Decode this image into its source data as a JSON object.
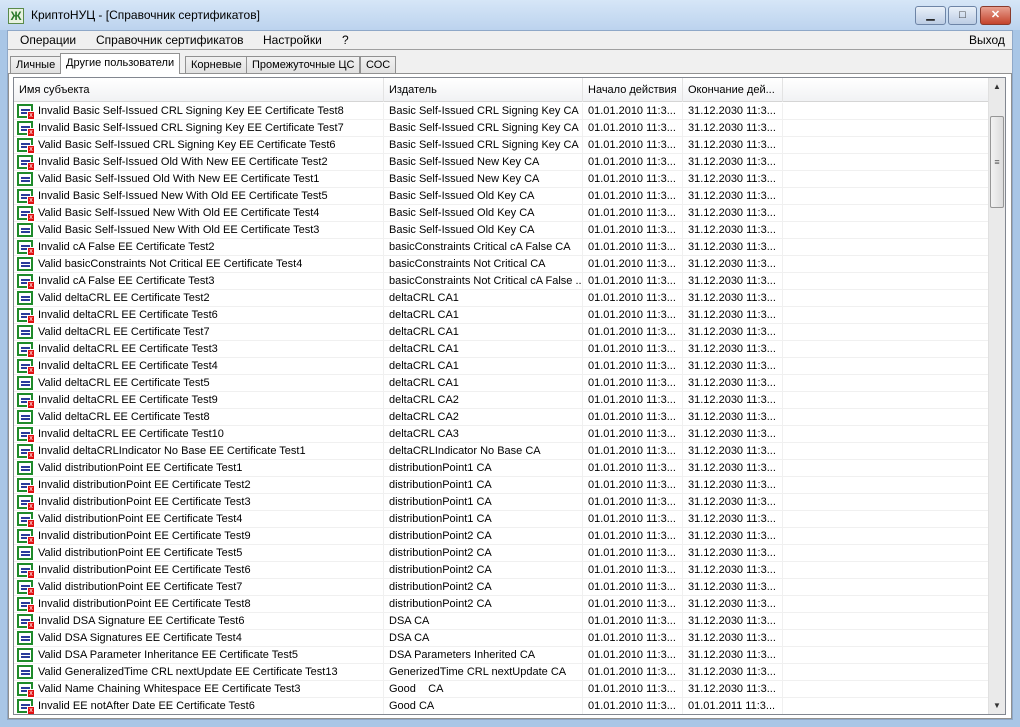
{
  "window": {
    "title": "КриптоНУЦ - [Справочник сертификатов]",
    "minimize": "▁",
    "maximize": "□",
    "close": "✕",
    "app_icon": "Ж"
  },
  "menu": {
    "items": [
      "Операции",
      "Справочник сертификатов",
      "Настройки",
      "?"
    ],
    "exit": "Выход"
  },
  "tabs": [
    "Личные",
    "Другие пользователи",
    "Корневые",
    "Промежуточные ЦС",
    "СОС"
  ],
  "active_tab": 1,
  "columns": [
    "Имя субъекта",
    "Издатель",
    "Начало действия",
    "Окончание дей..."
  ],
  "colors": {
    "valid_icon": "#1e8a2a",
    "error_badge": "#e01010"
  },
  "rows": [
    {
      "name": "Invalid Basic Self-Issued CRL Signing Key EE Certificate Test8",
      "issuer": "Basic Self-Issued CRL Signing Key CA",
      "start": "01.01.2010 11:3...",
      "end": "31.12.2030 11:3...",
      "error": true
    },
    {
      "name": "Invalid Basic Self-Issued CRL Signing Key EE Certificate Test7",
      "issuer": "Basic Self-Issued CRL Signing Key CA",
      "start": "01.01.2010 11:3...",
      "end": "31.12.2030 11:3...",
      "error": true
    },
    {
      "name": "Valid Basic Self-Issued CRL Signing Key EE Certificate Test6",
      "issuer": "Basic Self-Issued CRL Signing Key CA",
      "start": "01.01.2010 11:3...",
      "end": "31.12.2030 11:3...",
      "error": true
    },
    {
      "name": "Invalid Basic Self-Issued Old With New EE Certificate Test2",
      "issuer": "Basic Self-Issued New Key CA",
      "start": "01.01.2010 11:3...",
      "end": "31.12.2030 11:3...",
      "error": true
    },
    {
      "name": "Valid Basic Self-Issued Old With New EE Certificate Test1",
      "issuer": "Basic Self-Issued New Key CA",
      "start": "01.01.2010 11:3...",
      "end": "31.12.2030 11:3...",
      "error": false
    },
    {
      "name": "Invalid Basic Self-Issued New With Old EE Certificate Test5",
      "issuer": "Basic Self-Issued Old Key CA",
      "start": "01.01.2010 11:3...",
      "end": "31.12.2030 11:3...",
      "error": true
    },
    {
      "name": "Valid Basic Self-Issued New With Old EE Certificate Test4",
      "issuer": "Basic Self-Issued Old Key CA",
      "start": "01.01.2010 11:3...",
      "end": "31.12.2030 11:3...",
      "error": true
    },
    {
      "name": "Valid Basic Self-Issued New With Old EE Certificate Test3",
      "issuer": "Basic Self-Issued Old Key CA",
      "start": "01.01.2010 11:3...",
      "end": "31.12.2030 11:3...",
      "error": false
    },
    {
      "name": "Invalid cA False EE Certificate Test2",
      "issuer": "basicConstraints Critical cA False CA",
      "start": "01.01.2010 11:3...",
      "end": "31.12.2030 11:3...",
      "error": true
    },
    {
      "name": "Valid basicConstraints Not Critical EE Certificate Test4",
      "issuer": "basicConstraints Not Critical CA",
      "start": "01.01.2010 11:3...",
      "end": "31.12.2030 11:3...",
      "error": false
    },
    {
      "name": "Invalid cA False EE Certificate Test3",
      "issuer": "basicConstraints Not Critical cA False ...",
      "start": "01.01.2010 11:3...",
      "end": "31.12.2030 11:3...",
      "error": true
    },
    {
      "name": "Valid deltaCRL EE Certificate Test2",
      "issuer": "deltaCRL CA1",
      "start": "01.01.2010 11:3...",
      "end": "31.12.2030 11:3...",
      "error": false
    },
    {
      "name": "Invalid deltaCRL EE Certificate Test6",
      "issuer": "deltaCRL CA1",
      "start": "01.01.2010 11:3...",
      "end": "31.12.2030 11:3...",
      "error": true
    },
    {
      "name": "Valid deltaCRL EE Certificate Test7",
      "issuer": "deltaCRL CA1",
      "start": "01.01.2010 11:3...",
      "end": "31.12.2030 11:3...",
      "error": false
    },
    {
      "name": "Invalid deltaCRL EE Certificate Test3",
      "issuer": "deltaCRL CA1",
      "start": "01.01.2010 11:3...",
      "end": "31.12.2030 11:3...",
      "error": true
    },
    {
      "name": "Invalid deltaCRL EE Certificate Test4",
      "issuer": "deltaCRL CA1",
      "start": "01.01.2010 11:3...",
      "end": "31.12.2030 11:3...",
      "error": true
    },
    {
      "name": "Valid deltaCRL EE Certificate Test5",
      "issuer": "deltaCRL CA1",
      "start": "01.01.2010 11:3...",
      "end": "31.12.2030 11:3...",
      "error": false
    },
    {
      "name": "Invalid deltaCRL EE Certificate Test9",
      "issuer": "deltaCRL CA2",
      "start": "01.01.2010 11:3...",
      "end": "31.12.2030 11:3...",
      "error": true
    },
    {
      "name": "Valid deltaCRL EE Certificate Test8",
      "issuer": "deltaCRL CA2",
      "start": "01.01.2010 11:3...",
      "end": "31.12.2030 11:3...",
      "error": false
    },
    {
      "name": "Invalid deltaCRL EE Certificate Test10",
      "issuer": "deltaCRL CA3",
      "start": "01.01.2010 11:3...",
      "end": "31.12.2030 11:3...",
      "error": true
    },
    {
      "name": "Invalid deltaCRLIndicator No Base EE Certificate Test1",
      "issuer": "deltaCRLIndicator No Base CA",
      "start": "01.01.2010 11:3...",
      "end": "31.12.2030 11:3...",
      "error": true
    },
    {
      "name": "Valid distributionPoint EE Certificate Test1",
      "issuer": "distributionPoint1 CA",
      "start": "01.01.2010 11:3...",
      "end": "31.12.2030 11:3...",
      "error": false
    },
    {
      "name": "Invalid distributionPoint EE Certificate Test2",
      "issuer": "distributionPoint1 CA",
      "start": "01.01.2010 11:3...",
      "end": "31.12.2030 11:3...",
      "error": true
    },
    {
      "name": "Invalid distributionPoint EE Certificate Test3",
      "issuer": "distributionPoint1 CA",
      "start": "01.01.2010 11:3...",
      "end": "31.12.2030 11:3...",
      "error": true
    },
    {
      "name": "Valid distributionPoint EE Certificate Test4",
      "issuer": "distributionPoint1 CA",
      "start": "01.01.2010 11:3...",
      "end": "31.12.2030 11:3...",
      "error": true
    },
    {
      "name": "Invalid distributionPoint EE Certificate Test9",
      "issuer": "distributionPoint2 CA",
      "start": "01.01.2010 11:3...",
      "end": "31.12.2030 11:3...",
      "error": true
    },
    {
      "name": "Valid distributionPoint EE Certificate Test5",
      "issuer": "distributionPoint2 CA",
      "start": "01.01.2010 11:3...",
      "end": "31.12.2030 11:3...",
      "error": false
    },
    {
      "name": "Invalid distributionPoint EE Certificate Test6",
      "issuer": "distributionPoint2 CA",
      "start": "01.01.2010 11:3...",
      "end": "31.12.2030 11:3...",
      "error": true
    },
    {
      "name": "Valid distributionPoint EE Certificate Test7",
      "issuer": "distributionPoint2 CA",
      "start": "01.01.2010 11:3...",
      "end": "31.12.2030 11:3...",
      "error": true
    },
    {
      "name": "Invalid distributionPoint EE Certificate Test8",
      "issuer": "distributionPoint2 CA",
      "start": "01.01.2010 11:3...",
      "end": "31.12.2030 11:3...",
      "error": true
    },
    {
      "name": "Invalid DSA Signature EE Certificate Test6",
      "issuer": "DSA CA",
      "start": "01.01.2010 11:3...",
      "end": "31.12.2030 11:3...",
      "error": true
    },
    {
      "name": "Valid DSA Signatures EE Certificate Test4",
      "issuer": "DSA CA",
      "start": "01.01.2010 11:3...",
      "end": "31.12.2030 11:3...",
      "error": false
    },
    {
      "name": "Valid DSA Parameter Inheritance EE Certificate Test5",
      "issuer": "DSA Parameters Inherited CA",
      "start": "01.01.2010 11:3...",
      "end": "31.12.2030 11:3...",
      "error": false
    },
    {
      "name": "Valid GeneralizedTime CRL nextUpdate EE Certificate Test13",
      "issuer": "GenerizedTime CRL nextUpdate CA",
      "start": "01.01.2010 11:3...",
      "end": "31.12.2030 11:3...",
      "error": false
    },
    {
      "name": "Valid Name Chaining Whitespace EE Certificate Test3",
      "issuer": "Good    CA",
      "start": "01.01.2010 11:3...",
      "end": "31.12.2030 11:3...",
      "error": true
    },
    {
      "name": "Invalid EE notAfter Date EE Certificate Test6",
      "issuer": "Good CA",
      "start": "01.01.2010 11:3...",
      "end": "01.01.2011 11:3...",
      "error": true
    }
  ],
  "scrollbar": {
    "up": "▲",
    "down": "▼",
    "grip": "≡"
  }
}
